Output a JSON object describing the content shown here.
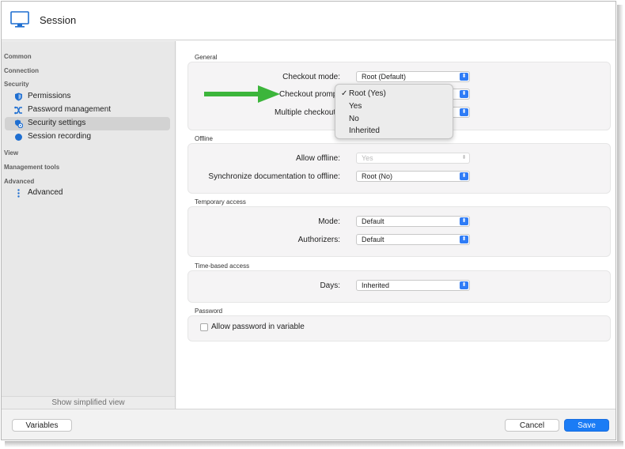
{
  "window": {
    "title": "Session",
    "icon": "monitor-icon"
  },
  "sidebar": {
    "groups": {
      "common": "Common",
      "connection": "Connection",
      "security": "Security",
      "view": "View",
      "management_tools": "Management tools",
      "advanced": "Advanced"
    },
    "items": {
      "permissions": {
        "label": "Permissions",
        "icon": "shield-icon"
      },
      "password_management": {
        "label": "Password management",
        "icon": "shuffle-icon"
      },
      "security_settings": {
        "label": "Security settings",
        "icon": "security-settings-icon",
        "selected": true
      },
      "session_recording": {
        "label": "Session recording",
        "icon": "record-dot-icon"
      },
      "advanced": {
        "label": "Advanced",
        "icon": "vertical-ellipsis-icon"
      }
    },
    "show_simplified": "Show simplified view"
  },
  "general": {
    "title": "General",
    "checkout_mode": {
      "label": "Checkout mode:",
      "value": "Root (Default)"
    },
    "checkout_prompt": {
      "label": "Checkout promp"
    },
    "multiple_checkouts": {
      "label": "Multiple checkouts"
    }
  },
  "dropdown_menu": {
    "check": "✓",
    "items": [
      "Root (Yes)",
      "Yes",
      "No",
      "Inherited"
    ],
    "selected_index": 0
  },
  "offline": {
    "title": "Offline",
    "allow_offline": {
      "label": "Allow offline:",
      "value": "Yes"
    },
    "sync_docs": {
      "label": "Synchronize documentation to offline:",
      "value": "Root (No)"
    }
  },
  "temporary_access": {
    "title": "Temporary access",
    "mode": {
      "label": "Mode:",
      "value": "Default"
    },
    "authorizers": {
      "label": "Authorizers:",
      "value": "Default"
    }
  },
  "time_based_access": {
    "title": "Time-based access",
    "days": {
      "label": "Days:",
      "value": "Inherited"
    }
  },
  "password": {
    "title": "Password",
    "allow_in_variable": {
      "label": "Allow password in variable",
      "checked": false
    }
  },
  "footer": {
    "variables": "Variables",
    "cancel": "Cancel",
    "save": "Save"
  },
  "colors": {
    "accent": "#1a7cf5",
    "callout_arrow": "#3cb53b",
    "selected_item": "#d2d2d2"
  }
}
